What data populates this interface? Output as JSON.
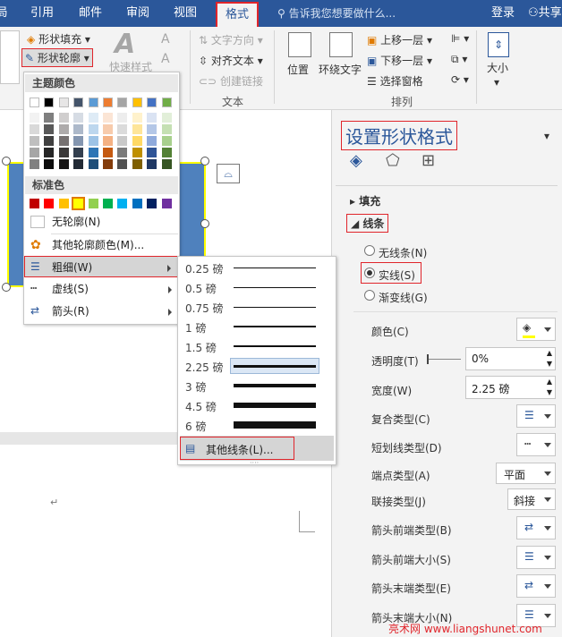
{
  "tabs": [
    "局",
    "引用",
    "邮件",
    "审阅",
    "视图",
    "格式"
  ],
  "tell_me": "告诉我您想要做什么...",
  "login": "登录",
  "share": "共享",
  "ribbon": {
    "shape_fill": "形状填充",
    "shape_outline": "形状轮廓",
    "quick_styles": "快速样式",
    "text_direction": "文字方向",
    "align_text": "对齐文本",
    "create_link": "创建链接",
    "group_text": "文本",
    "position": "位置",
    "wrap_text": "环绕文字",
    "bring_forward": "上移一层",
    "send_backward": "下移一层",
    "selection_pane": "选择窗格",
    "group_arrange": "排列",
    "size": "大小",
    "letter_a": "A"
  },
  "outline_menu": {
    "theme_colors_header": "主题颜色",
    "standard_colors_header": "标准色",
    "no_outline": "无轮廓(N)",
    "more_colors": "其他轮廓颜色(M)...",
    "weight": "粗细(W)",
    "dashes": "虚线(S)",
    "arrows": "箭头(R)",
    "theme_colors": [
      "#ffffff",
      "#000000",
      "#e7e6e6",
      "#44546a",
      "#5b9bd5",
      "#ed7d31",
      "#a5a5a5",
      "#ffc000",
      "#4472c4",
      "#70ad47"
    ],
    "shade_columns": [
      [
        "#f2f2f2",
        "#d9d9d9",
        "#bfbfbf",
        "#a6a6a6",
        "#808080"
      ],
      [
        "#7f7f7f",
        "#595959",
        "#404040",
        "#262626",
        "#0d0d0d"
      ],
      [
        "#d0cece",
        "#aeabab",
        "#767171",
        "#3a3838",
        "#171616"
      ],
      [
        "#d6dce4",
        "#adb9ca",
        "#8496b0",
        "#333f4f",
        "#222a35"
      ],
      [
        "#deebf6",
        "#bdd7ee",
        "#9dc3e6",
        "#2e75b5",
        "#1f4e79"
      ],
      [
        "#fbe5d5",
        "#f7cbac",
        "#f4b183",
        "#c55a11",
        "#833c0b"
      ],
      [
        "#ededed",
        "#dbdbdb",
        "#c9c9c9",
        "#7b7b7b",
        "#525252"
      ],
      [
        "#fff2cc",
        "#fee599",
        "#ffd965",
        "#bf9000",
        "#7f6000"
      ],
      [
        "#dae3f3",
        "#b4c7e7",
        "#8faadc",
        "#2f5496",
        "#1f3864"
      ],
      [
        "#e2efd9",
        "#c5e0b3",
        "#a8d08d",
        "#538135",
        "#375623"
      ]
    ],
    "standard_colors": [
      "#c00000",
      "#ff0000",
      "#ffc000",
      "#ffff00",
      "#92d050",
      "#00b050",
      "#00b0f0",
      "#0070c0",
      "#002060",
      "#7030a0"
    ]
  },
  "weight_menu": {
    "items": [
      "0.25 磅",
      "0.5 磅",
      "0.75 磅",
      "1 磅",
      "1.5 磅",
      "2.25 磅",
      "3 磅",
      "4.5 磅",
      "6 磅"
    ],
    "more_lines": "其他线条(L)..."
  },
  "pane": {
    "title": "设置形状格式",
    "fill": "填充",
    "line": "线条",
    "no_line": "无线条(N)",
    "solid_line": "实线(S)",
    "gradient_line": "渐变线(G)",
    "color": "颜色(C)",
    "transparency": "透明度(T)",
    "transparency_value": "0%",
    "width": "宽度(W)",
    "width_value": "2.25 磅",
    "compound": "复合类型(C)",
    "dash": "短划线类型(D)",
    "cap": "端点类型(A)",
    "cap_value": "平面",
    "join": "联接类型(J)",
    "join_value": "斜接",
    "begin_arrow_type": "箭头前端类型(B)",
    "begin_arrow_size": "箭头前端大小(S)",
    "end_arrow_type": "箭头末端类型(E)",
    "end_arrow_size": "箭头末端大小(N)"
  },
  "watermark": "亮术网 www.liangshunet.com",
  "colors": {
    "accent": "#2b579a",
    "highlight": "#e0252b",
    "shape_fill": "#4f81bd",
    "shape_outline": "#ffff00"
  }
}
